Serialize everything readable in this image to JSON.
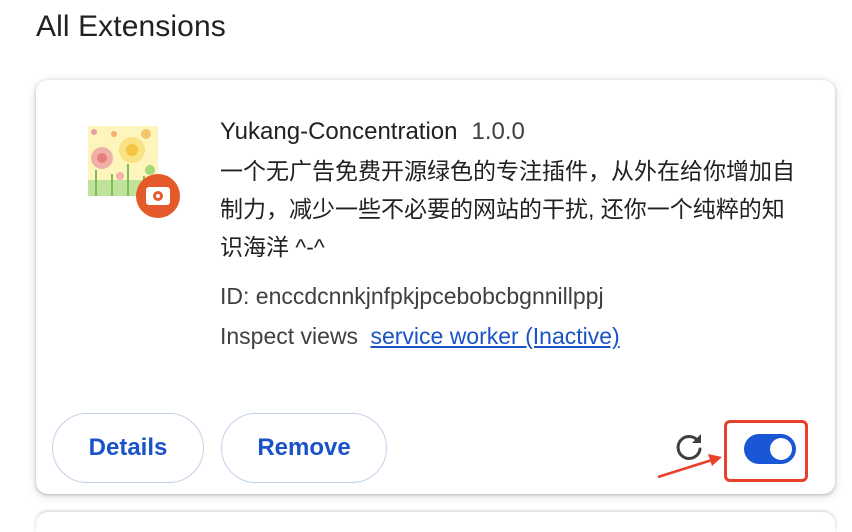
{
  "section": {
    "title": "All Extensions"
  },
  "extension": {
    "name": "Yukang-Concentration",
    "version": "1.0.0",
    "description": "一个无广告免费开源绿色的专注插件，从外在给你增加自制力，减少一些不必要的网站的干扰, 还你一个纯粹的知识海洋 ^-^",
    "id_text": "ID: enccdcnnkjnfpkjpcebobcbgnnillppj",
    "inspect_label": "Inspect views",
    "inspect_link": "service worker (Inactive)",
    "icon": "flower-field-with-camera-badge-icon",
    "enabled": true
  },
  "actions": {
    "details_label": "Details",
    "remove_label": "Remove",
    "reload_icon": "reload-icon"
  },
  "colors": {
    "accent": "#1a57d6",
    "link": "#1a53c8",
    "annotation": "#e8402a"
  }
}
